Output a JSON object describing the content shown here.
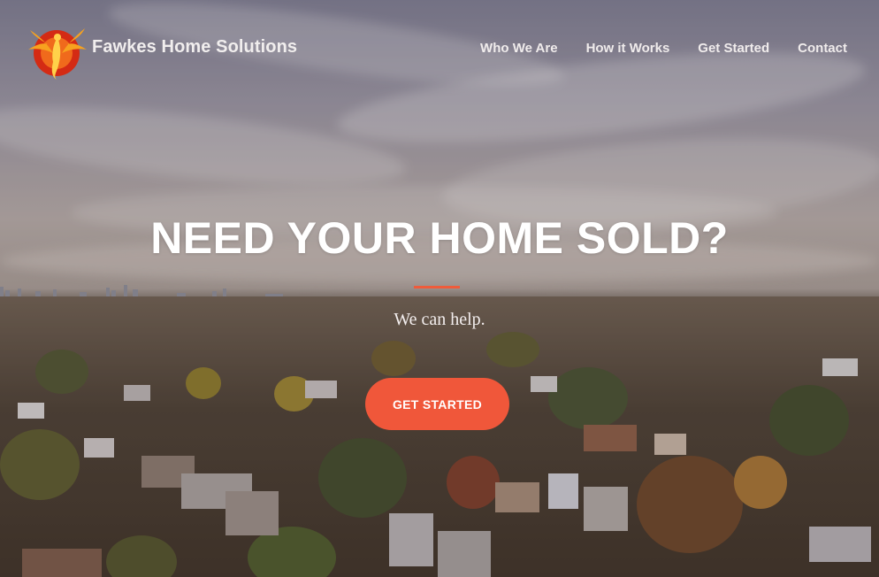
{
  "brand": {
    "name": "Fawkes Home Solutions",
    "logo_icon": "phoenix-icon"
  },
  "nav": {
    "items": [
      {
        "label": "Who We Are"
      },
      {
        "label": "How it Works"
      },
      {
        "label": "Get Started"
      },
      {
        "label": "Contact"
      }
    ]
  },
  "hero": {
    "headline": "NEED YOUR HOME SOLD?",
    "subheadline": "We can help.",
    "cta_label": "GET STARTED"
  },
  "colors": {
    "accent": "#f0573a",
    "text": "#ffffff"
  }
}
